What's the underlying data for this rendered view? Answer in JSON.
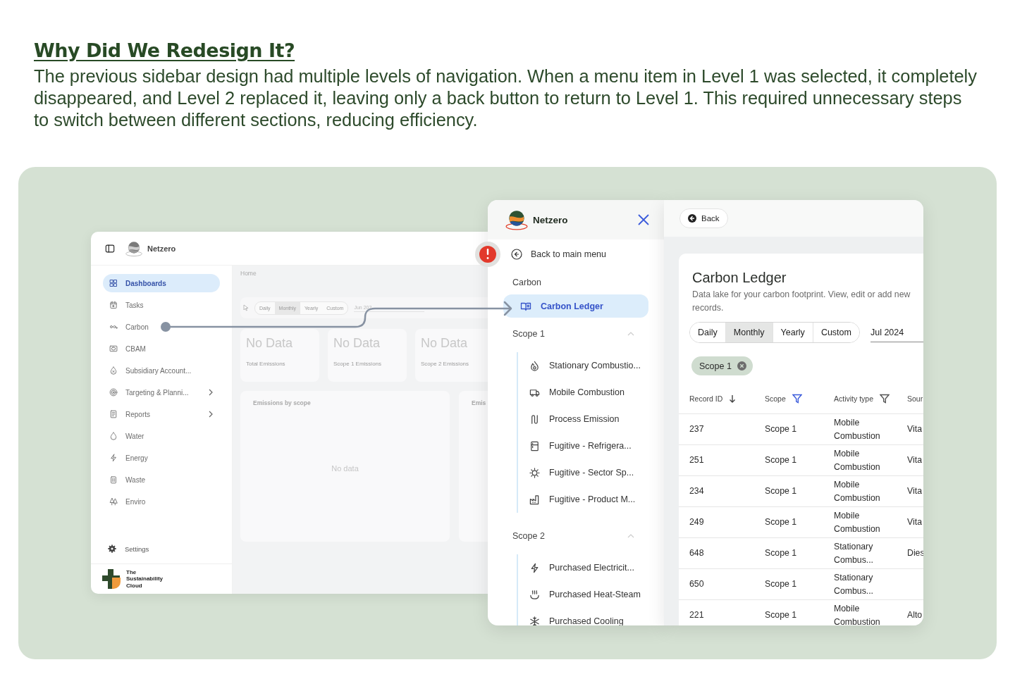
{
  "heading": "Why Did We Redesign It?",
  "intro": "The previous sidebar design had multiple levels of navigation. When a menu item in Level 1 was selected, it completely disappeared, and Level 2 replaced it, leaving only a back button to return to Level 1. This required unnecessary steps to switch between different sections, reducing efficiency.",
  "old_app": {
    "brand": "Netzero",
    "nav": [
      {
        "label": "Dashboards",
        "selected": true,
        "submenu": false
      },
      {
        "label": "Tasks",
        "selected": false,
        "submenu": false
      },
      {
        "label": "Carbon",
        "selected": false,
        "submenu": false
      },
      {
        "label": "CBAM",
        "selected": false,
        "submenu": false
      },
      {
        "label": "Subsidiary Account...",
        "selected": false,
        "submenu": false
      },
      {
        "label": "Targeting & Planni...",
        "selected": false,
        "submenu": true
      },
      {
        "label": "Reports",
        "selected": false,
        "submenu": true
      },
      {
        "label": "Water",
        "selected": false,
        "submenu": false
      },
      {
        "label": "Energy",
        "selected": false,
        "submenu": false
      },
      {
        "label": "Waste",
        "selected": false,
        "submenu": false
      },
      {
        "label": "Enviro",
        "selected": false,
        "submenu": false
      }
    ],
    "settings": "Settings",
    "footer": "The Sustainability Cloud",
    "breadcrumb": "Home",
    "periods": [
      {
        "label": "Daily",
        "selected": false
      },
      {
        "label": "Monthly",
        "selected": true
      },
      {
        "label": "Yearly",
        "selected": false
      },
      {
        "label": "Custom",
        "selected": false
      }
    ],
    "date": "Jun 202",
    "stats": [
      {
        "value": "No Data",
        "label": "Total Emissions"
      },
      {
        "value": "No Data",
        "label": "Scope 1 Emissions"
      },
      {
        "value": "No Data",
        "label": "Scope 2 Emissions"
      }
    ],
    "charts": [
      {
        "title": "Emissions by scope",
        "empty": "No data"
      },
      {
        "title": "Emis"
      }
    ]
  },
  "new_menu": {
    "brand": "Netzero",
    "back": "Back to main menu",
    "section": "Carbon",
    "items": [
      {
        "label": "Carbon Ledger",
        "selected": true
      }
    ],
    "groups": [
      {
        "title": "Scope 1",
        "expanded": true,
        "children": [
          {
            "label": "Stationary Combustio..."
          },
          {
            "label": "Mobile Combustion"
          },
          {
            "label": "Process Emission"
          },
          {
            "label": "Fugitive - Refrigera..."
          },
          {
            "label": "Fugitive - Sector Sp..."
          },
          {
            "label": "Fugitive - Product M..."
          }
        ]
      },
      {
        "title": "Scope 2",
        "expanded": true,
        "children": [
          {
            "label": "Purchased Electricit..."
          },
          {
            "label": "Purchased Heat-Steam"
          },
          {
            "label": "Purchased Cooling"
          }
        ]
      }
    ]
  },
  "ledger": {
    "back": "Back",
    "title": "Carbon Ledger",
    "description": "Data lake for your carbon footprint. View, edit or add new records.",
    "periods": [
      {
        "label": "Daily",
        "selected": false
      },
      {
        "label": "Monthly",
        "selected": true
      },
      {
        "label": "Yearly",
        "selected": false
      },
      {
        "label": "Custom",
        "selected": false
      }
    ],
    "date": "Jul 2024",
    "filters": [
      {
        "label": "Scope 1"
      }
    ],
    "columns": [
      {
        "label": "Record ID",
        "kind": "sort"
      },
      {
        "label": "Scope",
        "kind": "filter",
        "active": true
      },
      {
        "label": "Activity type",
        "kind": "filter",
        "active": false
      },
      {
        "label": "Sour",
        "kind": "plain"
      }
    ],
    "rows": [
      {
        "record_id": "237",
        "scope": "Scope 1",
        "activity_type": "Mobile Combustion",
        "source": "Vita"
      },
      {
        "record_id": "251",
        "scope": "Scope 1",
        "activity_type": "Mobile Combustion",
        "source": "Vita"
      },
      {
        "record_id": "234",
        "scope": "Scope 1",
        "activity_type": "Mobile Combustion",
        "source": "Vita"
      },
      {
        "record_id": "249",
        "scope": "Scope 1",
        "activity_type": "Mobile Combustion",
        "source": "Vita"
      },
      {
        "record_id": "648",
        "scope": "Scope 1",
        "activity_type": "Stationary Combus...",
        "source": "Dies"
      },
      {
        "record_id": "650",
        "scope": "Scope 1",
        "activity_type": "Stationary Combus..."
      },
      {
        "record_id": "221",
        "scope": "Scope 1",
        "activity_type": "Mobile Combustion",
        "source": "Alto"
      }
    ]
  }
}
